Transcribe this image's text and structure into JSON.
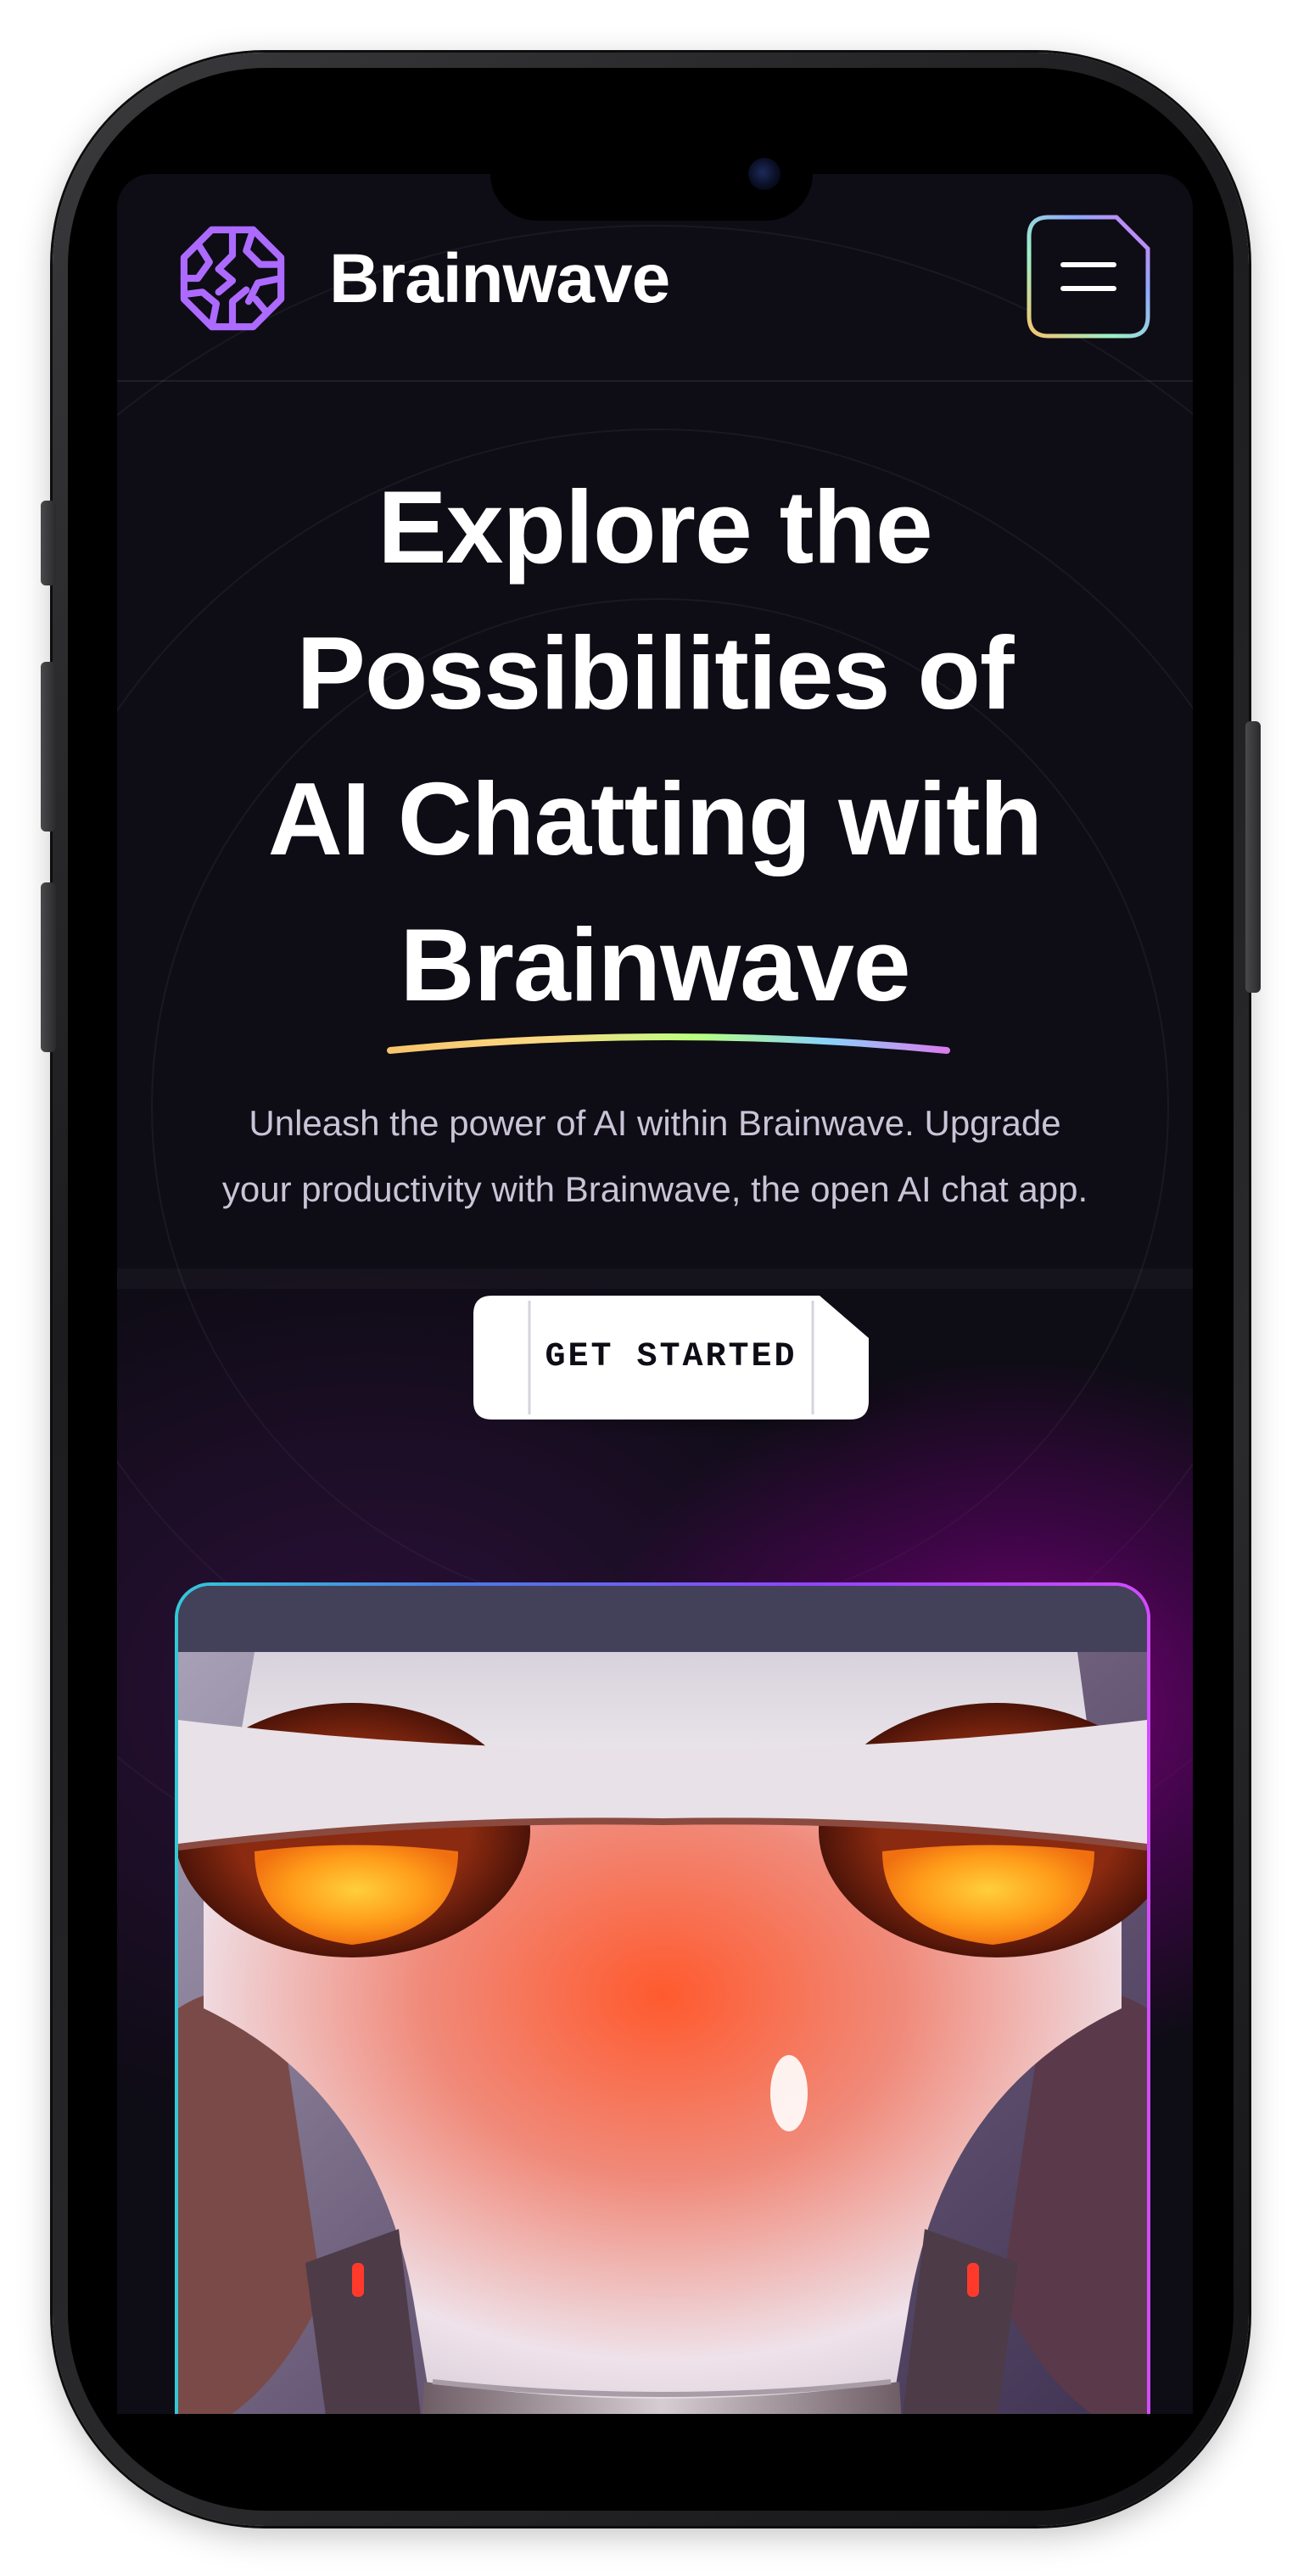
{
  "app": {
    "name": "Brainwave"
  },
  "header": {
    "logo_text": "Brainwave",
    "logo_icon": "brain-icon",
    "menu_icon": "hamburger-menu-icon"
  },
  "hero": {
    "title_lines": [
      "Explore the",
      "Possibilities of",
      "AI Chatting with",
      "Brainwave"
    ],
    "subtitle_lines": [
      "Unleash the power of AI within Brainwave. Upgrade",
      "your productivity with Brainwave, the open AI chat app."
    ],
    "cta_label": "GET STARTED"
  },
  "colors": {
    "background": "#0e0c15",
    "logo_purple": "#ac6aff",
    "accent_gradient": [
      "#33c8d6",
      "#8f46ff",
      "#d24cff"
    ],
    "underline_gradient": [
      "#89f9e8",
      "#facb7b",
      "#b9ff7f",
      "#d87cee"
    ],
    "robot_eye": "#ff9c1a"
  }
}
